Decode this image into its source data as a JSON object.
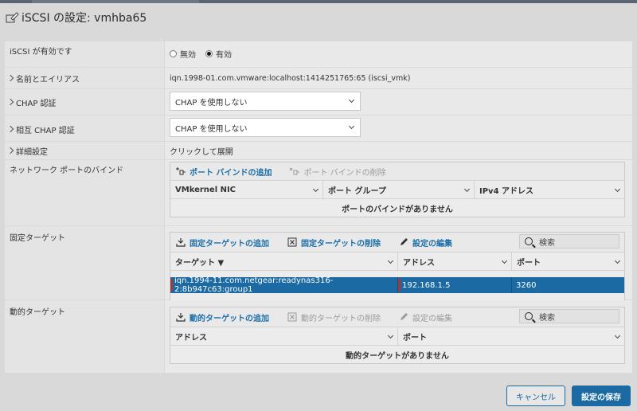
{
  "title": "iSCSI の設定: vmhba65",
  "rows": {
    "enabled": {
      "label": "iSCSI が有効です",
      "opt_off": "無効",
      "opt_on": "有効",
      "selected": "有効"
    },
    "name": {
      "label": "名前とエイリアス",
      "value": "iqn.1998-01.com.vmware:localhost:1414251765:65 (iscsi_vmk)"
    },
    "chap": {
      "label": "CHAP 認証",
      "value": "CHAP を使用しない"
    },
    "mutual_chap": {
      "label": "相互 CHAP 認証",
      "value": "CHAP を使用しない"
    },
    "advanced": {
      "label": "詳細設定",
      "value": "クリックして展開"
    },
    "port_binding": {
      "label": "ネットワーク ポートのバインド",
      "add": "ポート バインドの追加",
      "remove": "ポート バインドの削除",
      "columns": [
        "VMkernel NIC",
        "ポート グループ",
        "IPv4 アドレス"
      ],
      "empty": "ポートのバインドがありません"
    },
    "static_targets": {
      "label": "固定ターゲット",
      "add": "固定ターゲットの追加",
      "remove": "固定ターゲットの削除",
      "edit": "設定の編集",
      "search": "検索",
      "columns": [
        "ターゲット ▼",
        "アドレス",
        "ポート"
      ],
      "row": {
        "target": "iqn.1994-11.com.netgear:readynas316-2:8b947c63:group1",
        "address": "192.168.1.5",
        "port": "3260"
      }
    },
    "dynamic_targets": {
      "label": "動的ターゲット",
      "add": "動的ターゲットの追加",
      "remove": "動的ターゲットの削除",
      "edit": "設定の編集",
      "search": "検索",
      "columns": [
        "アドレス",
        "ポート"
      ],
      "empty": "動的ターゲットがありません"
    }
  },
  "buttons": {
    "cancel": "キャンセル",
    "save": "設定の保存"
  },
  "colors": {
    "accent": "#1c6aa3",
    "selected_row": "#1c6aa3",
    "link": "#1b6fa8"
  }
}
